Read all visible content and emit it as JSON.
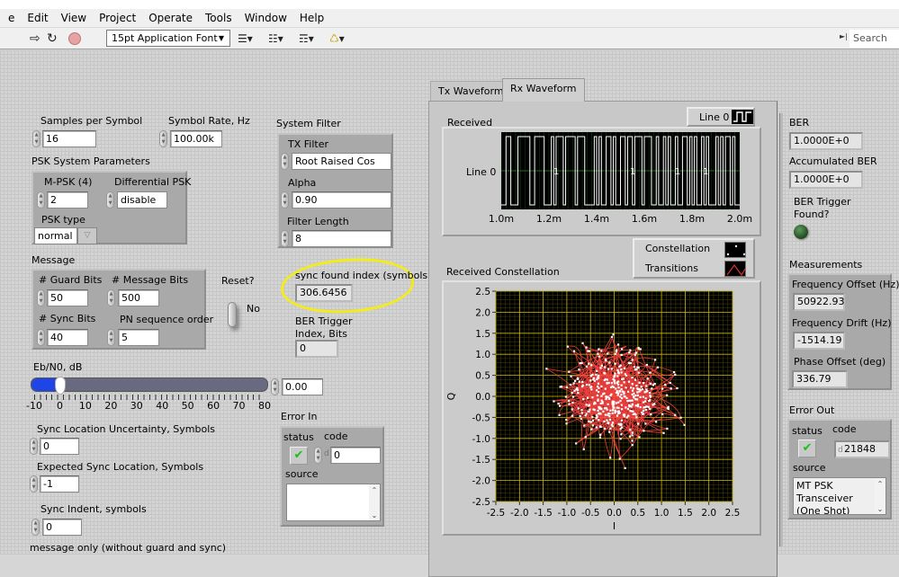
{
  "menu": [
    "e",
    "Edit",
    "View",
    "Project",
    "Operate",
    "Tools",
    "Window",
    "Help"
  ],
  "toolbar": {
    "icons": [
      "run-arrow-icon",
      "run-continuously-icon",
      "abort-icon"
    ],
    "font_select": "15pt Application Font",
    "search_placeholder": "Search"
  },
  "controls": {
    "samples_per_symbol": {
      "label": "Samples per Symbol",
      "value": "16"
    },
    "symbol_rate": {
      "label": "Symbol Rate, Hz",
      "value": "100.00k"
    },
    "psk_system": {
      "title": "PSK System Parameters",
      "m_psk": {
        "label": "M-PSK (4)",
        "value": "2"
      },
      "differential": {
        "label": "Differential PSK",
        "value": "disable"
      },
      "psk_type": {
        "label": "PSK type",
        "value": "normal"
      }
    },
    "system_filter": {
      "title": "System Filter",
      "tx_filter": {
        "label": "TX Filter",
        "value": "Root Raised Cos"
      },
      "alpha": {
        "label": "Alpha",
        "value": "0.90"
      },
      "filter_length": {
        "label": "Filter Length",
        "value": "8"
      }
    },
    "message": {
      "title": "Message",
      "guard_bits": {
        "label": "# Guard Bits",
        "value": "50"
      },
      "message_bits": {
        "label": "# Message Bits",
        "value": "500"
      },
      "sync_bits": {
        "label": "# Sync Bits",
        "value": "40"
      },
      "pn_order": {
        "label": "PN sequence order",
        "value": "5"
      }
    },
    "reset": {
      "label": "Reset?",
      "state": "No"
    },
    "sync_found": {
      "label": "sync found index (symbols)",
      "value": "306.6456"
    },
    "ber_trigger_index": {
      "label_line1": "BER Trigger",
      "label_line2": "Index, Bits",
      "value": "0"
    },
    "ebn0": {
      "label": "Eb/N0, dB",
      "value": "0.00",
      "value_num": 0,
      "min": -10,
      "max": 80,
      "scale": [
        "-10",
        "0",
        "10",
        "20",
        "30",
        "40",
        "50",
        "60",
        "70",
        "80"
      ]
    },
    "sync_uncertainty": {
      "label": "Sync Location Uncertainty, Symbols",
      "value": "0"
    },
    "expected_sync": {
      "label": "Expected Sync Location, Symbols",
      "value": "-1"
    },
    "sync_indent": {
      "label": "Sync Indent, symbols",
      "value": "0"
    },
    "footnote": "message only (without guard and sync)"
  },
  "error_in": {
    "title": "Error In",
    "status_label": "status",
    "code_label": "code",
    "code_prefix": "d",
    "code": "0",
    "source_label": "source",
    "source": ""
  },
  "tabs": [
    {
      "label": "Tx Waveform",
      "active": false
    },
    {
      "label": "Rx Waveform",
      "active": true
    }
  ],
  "received_graph": {
    "title": "Received",
    "legend_label": "Line 0",
    "y_label": "Line 0",
    "bit_markers": [
      "1",
      "1",
      "1",
      "1"
    ],
    "x_ticks": [
      "1.0m",
      "1.2m",
      "1.4m",
      "1.6m",
      "1.8m",
      "2.0m"
    ],
    "xlim": [
      0.001,
      0.002
    ]
  },
  "constellation": {
    "title": "Received Constellation",
    "legend": [
      {
        "label": "Constellation"
      },
      {
        "label": "Transitions"
      }
    ],
    "x_label": "I",
    "y_label": "Q",
    "x_ticks": [
      "-2.5",
      "-2.0",
      "-1.5",
      "-1.0",
      "-0.5",
      "0.0",
      "0.5",
      "1.0",
      "1.5",
      "2.0",
      "2.5"
    ],
    "y_ticks": [
      "2.5",
      "2.0",
      "1.5",
      "1.0",
      "0.5",
      "0.0",
      "-0.5",
      "-1.0",
      "-1.5",
      "-2.0",
      "-2.5"
    ],
    "xlim": [
      -2.5,
      2.5
    ],
    "ylim": [
      -2.5,
      2.5
    ],
    "colors": {
      "trace": "#ff4444",
      "points": "#ffffff",
      "grid": "#c8b400",
      "plot_bg": "#000000"
    }
  },
  "ber": {
    "ber_label": "BER",
    "ber_value": "1.0000E+0",
    "acc_label": "Accumulated BER",
    "acc_value": "1.0000E+0",
    "trigger_label_line1": "BER Trigger",
    "trigger_label_line2": "Found?",
    "trigger_state": false
  },
  "measurements": {
    "title": "Measurements",
    "freq_offset": {
      "label": "Frequency Offset (Hz)",
      "value": "50922.93"
    },
    "freq_drift": {
      "label": "Frequency Drift (Hz)",
      "value": "-1514.19"
    },
    "phase_offset": {
      "label": "Phase Offset (deg)",
      "value": "336.79"
    }
  },
  "error_out": {
    "title": "Error Out",
    "status_label": "status",
    "code_label": "code",
    "code_prefix": "d",
    "code": "21848",
    "source_label": "source",
    "source": "MT PSK Transceiver (One Shot) sync"
  }
}
